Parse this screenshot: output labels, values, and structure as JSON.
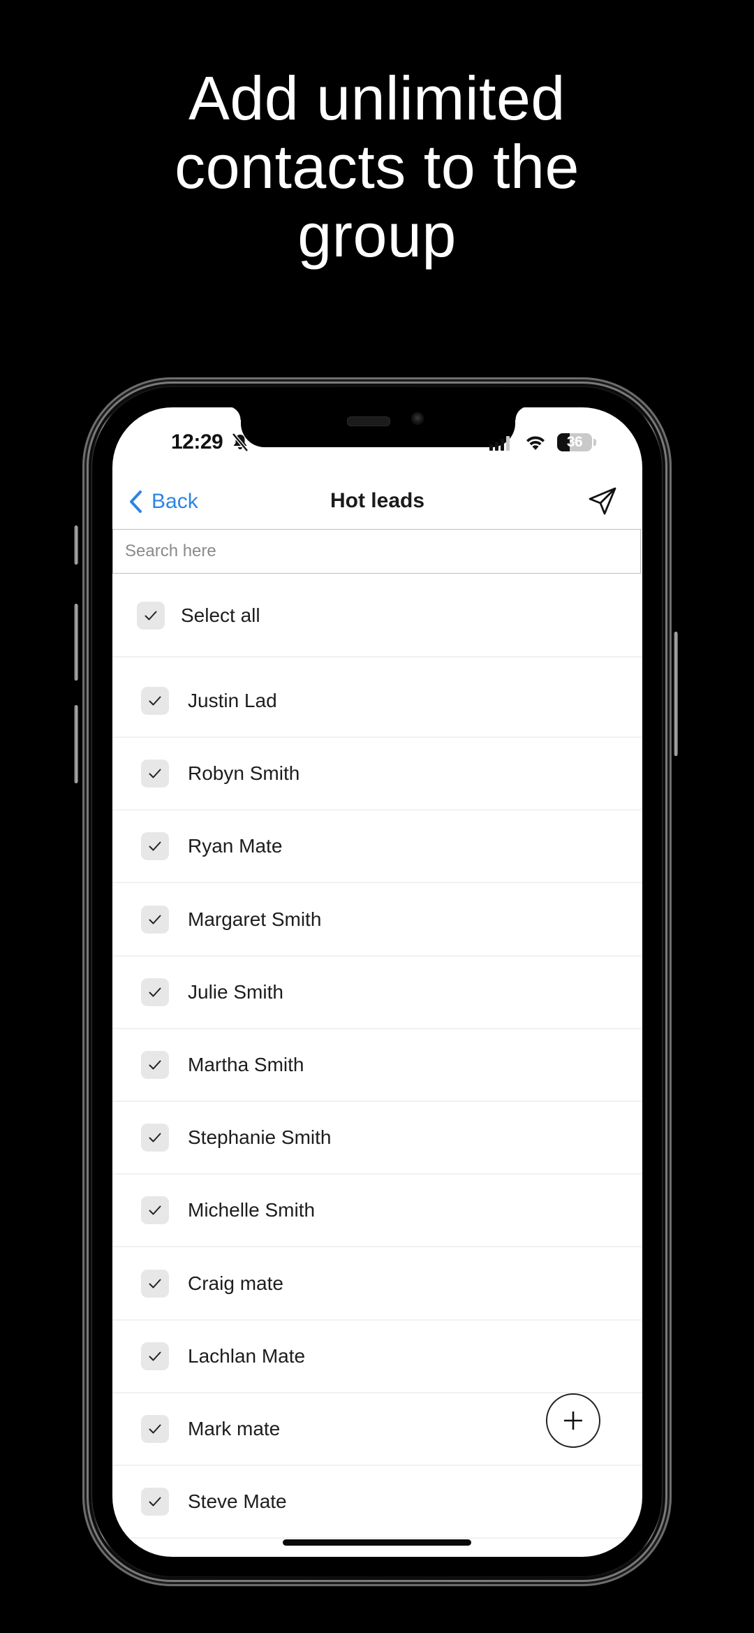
{
  "headline": {
    "lines": [
      "Add unlimited",
      "contacts to the",
      "group"
    ]
  },
  "status_bar": {
    "time": "12:29",
    "silent_icon": "bell-slash-icon",
    "signal_icon": "cellular-signal-icon",
    "wifi_icon": "wifi-icon",
    "battery_percent": 36,
    "battery_label": "36"
  },
  "nav": {
    "back_label": "Back",
    "back_icon": "chevron-left-icon",
    "title": "Hot leads",
    "send_icon": "paper-plane-icon"
  },
  "search": {
    "placeholder": "Search here",
    "value": ""
  },
  "select_all": {
    "label": "Select all",
    "checked": true
  },
  "contacts": [
    {
      "name": "Justin Lad",
      "checked": true
    },
    {
      "name": "Robyn Smith",
      "checked": true
    },
    {
      "name": "Ryan Mate",
      "checked": true
    },
    {
      "name": "Margaret Smith",
      "checked": true
    },
    {
      "name": "Julie Smith",
      "checked": true
    },
    {
      "name": "Martha Smith",
      "checked": true
    },
    {
      "name": "Stephanie Smith",
      "checked": true
    },
    {
      "name": "Michelle Smith",
      "checked": true
    },
    {
      "name": "Craig mate",
      "checked": true
    },
    {
      "name": "Lachlan Mate",
      "checked": true
    },
    {
      "name": "Mark mate",
      "checked": true
    },
    {
      "name": "Steve Mate",
      "checked": true
    }
  ],
  "fab": {
    "icon": "plus-icon"
  },
  "colors": {
    "accent": "#2d84e3",
    "background": "#000000",
    "screen": "#ffffff",
    "checkbox_fill": "#e7e7e7"
  }
}
